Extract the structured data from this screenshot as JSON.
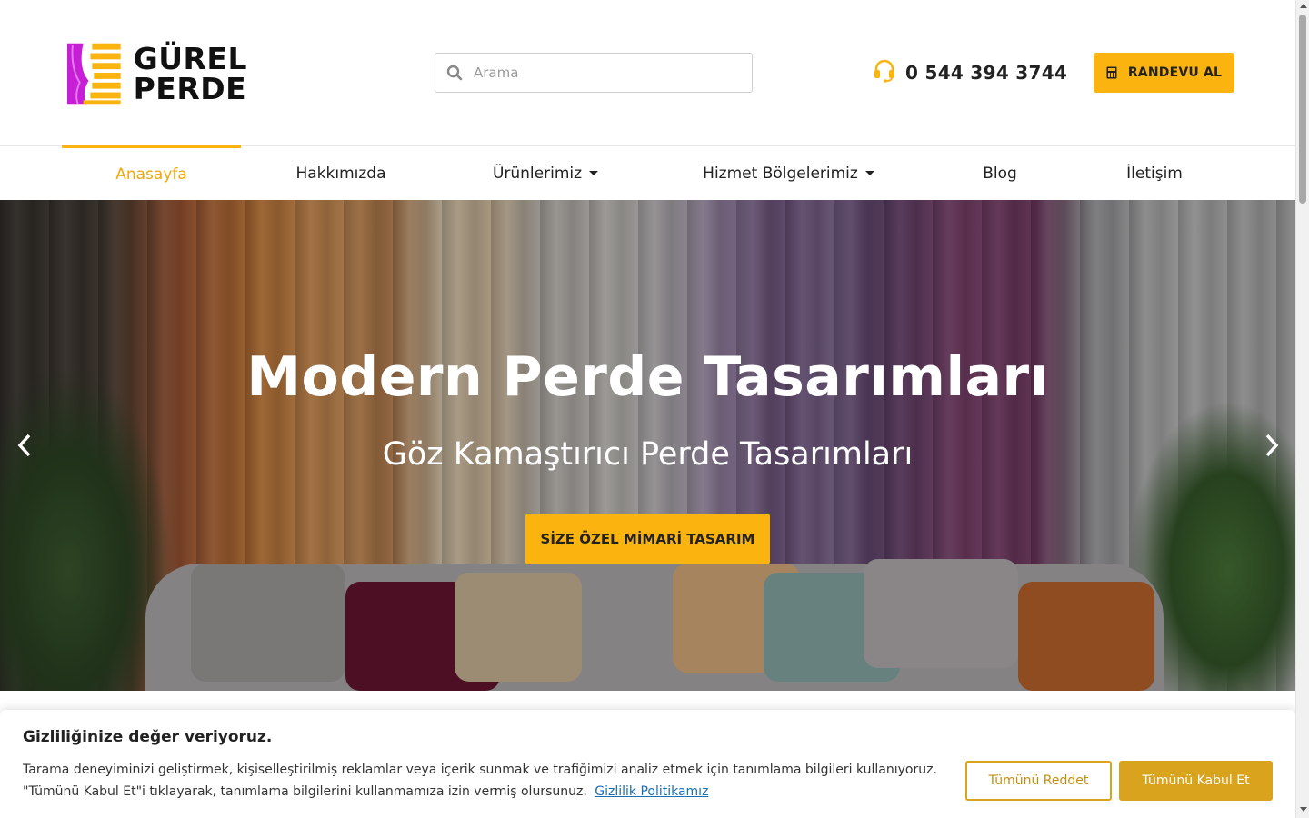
{
  "brand": {
    "name_line1": "GÜREL",
    "name_line2": "PERDE",
    "colors": {
      "accent": "#fbb40f",
      "logo_purple": "#c71fd6"
    }
  },
  "header": {
    "search_placeholder": "Arama",
    "phone": "0 544 394 3744",
    "appointment_button": "RANDEVU AL"
  },
  "nav": {
    "items": [
      {
        "label": "Anasayfa",
        "active": true
      },
      {
        "label": "Hakkımızda"
      },
      {
        "label": "Ürünlerimiz",
        "dropdown": true
      },
      {
        "label": "Hizmet Bölgelerimiz",
        "dropdown": true
      },
      {
        "label": "Blog"
      },
      {
        "label": "İletişim"
      }
    ]
  },
  "hero": {
    "title": "Modern Perde Tasarımları",
    "subtitle": "Göz Kamaştırıcı Perde Tasarımları",
    "cta": "SİZE ÖZEL MİMARİ TASARIM"
  },
  "cookie": {
    "title": "Gizliliğinize değer veriyoruz.",
    "text": "Tarama deneyiminizi geliştirmek, kişiselleştirilmiş reklamlar veya içerik sunmak ve trafiğimizi analiz etmek için tanımlama bilgileri kullanıyoruz. \"Tümünü Kabul Et\"i tıklayarak, tanımlama bilgilerini kullanmamıza izin vermiş olursunuz.",
    "policy_link": "Gizlilik Politikamız",
    "reject_button": "Tümünü Reddet",
    "accept_button": "Tümünü Kabul Et"
  }
}
